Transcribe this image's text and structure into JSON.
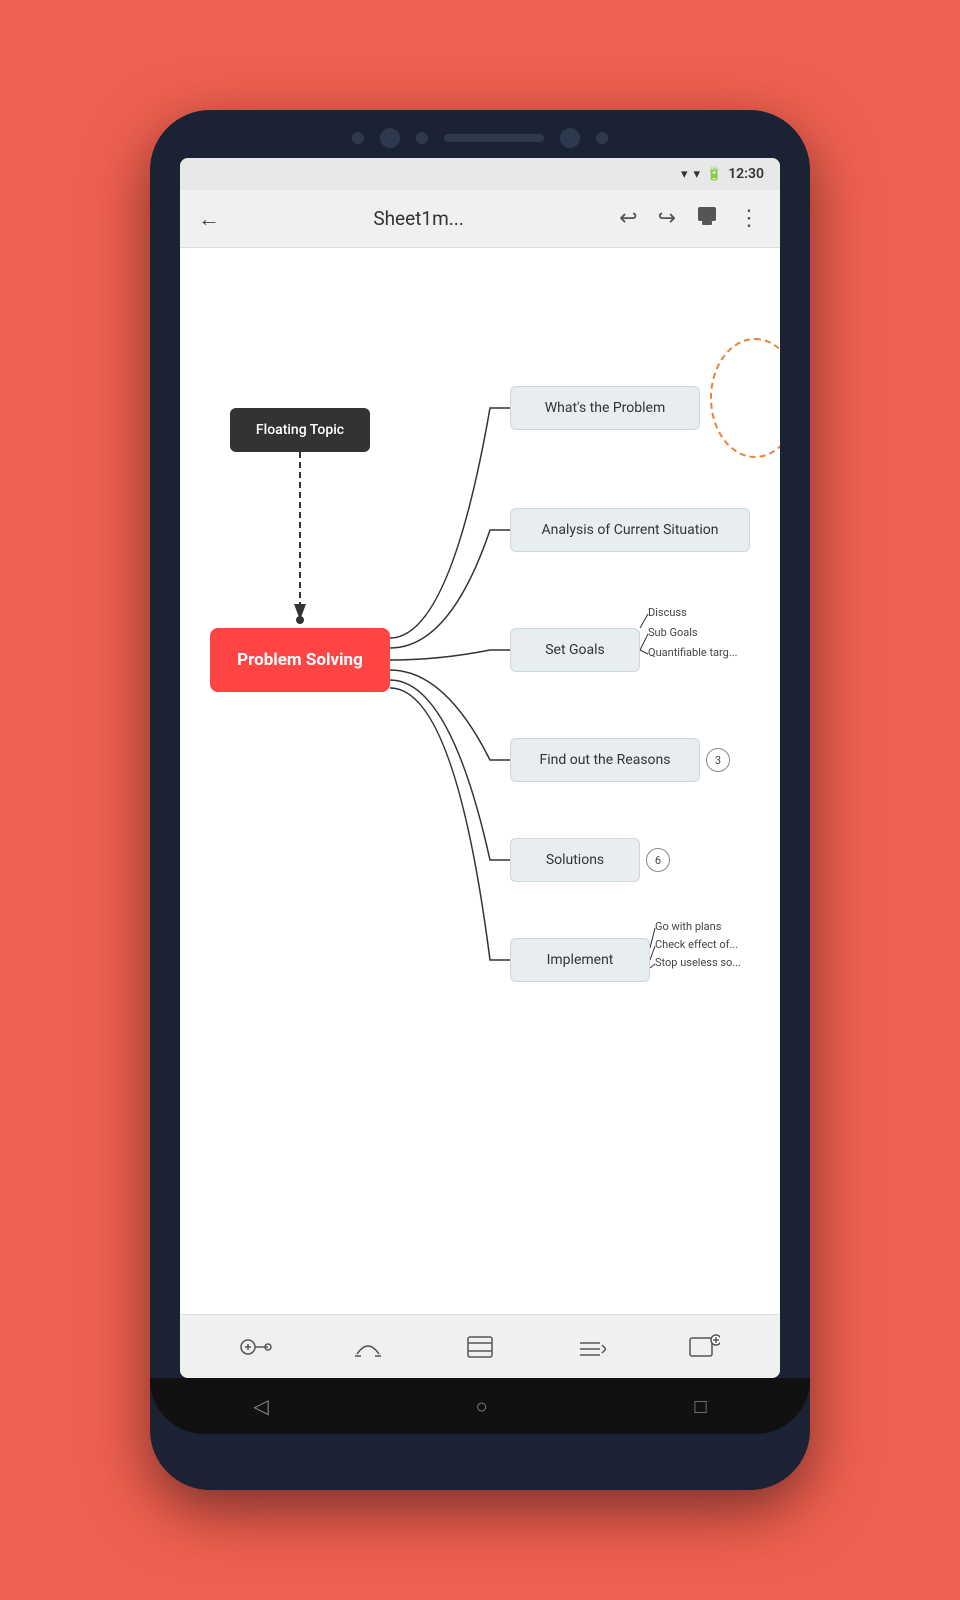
{
  "status": {
    "time": "12:30",
    "wifi": "▾",
    "signal": "▾",
    "battery": "▮"
  },
  "toolbar": {
    "back_label": "←",
    "title": "Sheet1m...",
    "undo_label": "↩",
    "redo_label": "↪",
    "paint_label": "🖌",
    "more_label": "⋮"
  },
  "mindmap": {
    "central_node": "Problem Solving",
    "floating_node": "Floating Topic",
    "branches": [
      {
        "label": "What's the Problem",
        "badge": null
      },
      {
        "label": "Analysis of Current Situation",
        "badge": null
      },
      {
        "label": "Set Goals",
        "badge": null
      },
      {
        "label": "Find out the Reasons",
        "badge": "3"
      },
      {
        "label": "Solutions",
        "badge": "6"
      },
      {
        "label": "Implement",
        "badge": null
      }
    ],
    "goals_sub": [
      "Discuss",
      "Sub Goals",
      "Quantifiable targ..."
    ],
    "implement_sub": [
      "Go with plans",
      "Check effect of...",
      "Stop useless so..."
    ]
  },
  "bottom_toolbar": {
    "add_topic": "+",
    "connect": "⌢",
    "card": "▭",
    "outline": "≡",
    "add_subtopic": "+"
  },
  "nav": {
    "back": "◁",
    "home": "○",
    "recent": "□"
  }
}
